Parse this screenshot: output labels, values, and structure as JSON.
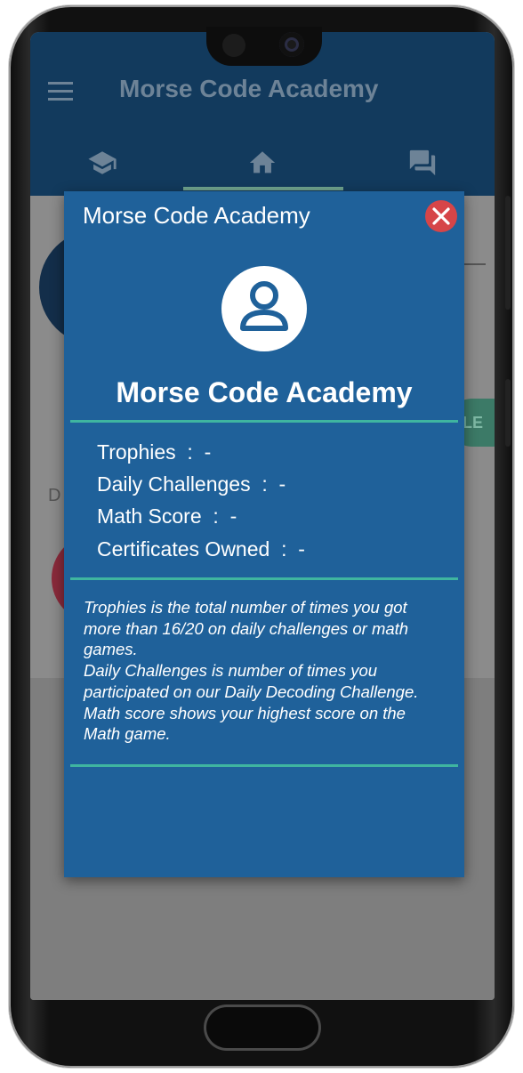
{
  "app": {
    "title": "Morse Code Academy",
    "tabs": [
      {
        "icon": "graduation-cap-icon"
      },
      {
        "icon": "home-icon",
        "selected": true
      },
      {
        "icon": "chat-icon"
      }
    ],
    "background_pill_text": "LE",
    "background_section_letter": "D"
  },
  "dialog": {
    "header": "Morse Code Academy",
    "close_icon": "close-icon",
    "avatar_icon": "account-circle-icon",
    "name": "Morse Code Academy",
    "stats": [
      {
        "label": "Trophies",
        "sep": "  :  ",
        "value": "-"
      },
      {
        "label": "Daily Challenges",
        "sep": "  :  ",
        "value": "-"
      },
      {
        "label": "Math Score",
        "sep": "  :  ",
        "value": "-"
      },
      {
        "label": "Certificates Owned",
        "sep": "  :  ",
        "value": "-"
      }
    ],
    "description_lines": [
      "Trophies is the total number of times you got",
      "more than 16/20 on daily challenges or  math",
      "games.",
      "Daily Challenges is number of times you",
      "participated on our Daily Decoding Challenge.",
      "Math score shows your highest score on the",
      "Math game."
    ]
  },
  "colors": {
    "dialog_bg": "#1f619a",
    "divider": "#3fb5a0",
    "close_button": "#d64548",
    "appbar": "#123a5d"
  }
}
